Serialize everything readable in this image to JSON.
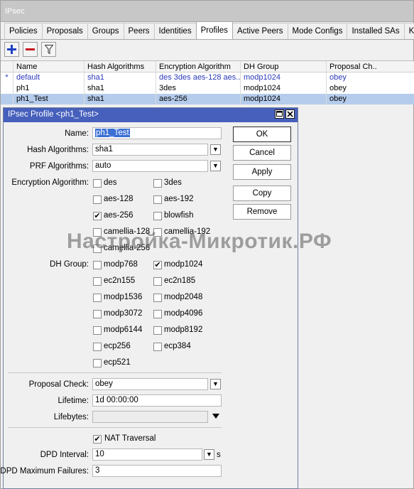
{
  "window": {
    "title": "IPsec"
  },
  "tabs": [
    "Policies",
    "Proposals",
    "Groups",
    "Peers",
    "Identities",
    "Profiles",
    "Active Peers",
    "Mode Configs",
    "Installed SAs",
    "Keys"
  ],
  "active_tab": "Profiles",
  "toolbar": {
    "add": "+",
    "remove": "−"
  },
  "grid": {
    "columns": [
      "Name",
      "Hash Algorithms",
      "Encryption Algorithm",
      "DH Group",
      "Proposal Ch..."
    ],
    "rows": [
      {
        "flag": "*",
        "name": "default",
        "hash": "sha1",
        "enc": "des 3des aes-128 aes...",
        "dh": "modp1024",
        "proposal": "obey"
      },
      {
        "flag": "",
        "name": "ph1",
        "hash": "sha1",
        "enc": "3des",
        "dh": "modp1024",
        "proposal": "obey"
      },
      {
        "flag": "",
        "name": "ph1_Test",
        "hash": "sha1",
        "enc": "aes-256",
        "dh": "modp1024",
        "proposal": "obey"
      }
    ]
  },
  "dialog": {
    "title": "IPsec Profile <ph1_Test>",
    "name_label": "Name:",
    "name_value": "ph1_Test",
    "hash_label": "Hash Algorithms:",
    "hash_value": "sha1",
    "prf_label": "PRF Algorithms:",
    "prf_value": "auto",
    "enc_label": "Encryption Algorithm:",
    "enc_options": [
      {
        "label": "des",
        "checked": false
      },
      {
        "label": "3des",
        "checked": false
      },
      {
        "label": "aes-128",
        "checked": false
      },
      {
        "label": "aes-192",
        "checked": false
      },
      {
        "label": "aes-256",
        "checked": true
      },
      {
        "label": "blowfish",
        "checked": false
      },
      {
        "label": "camellia-128",
        "checked": false
      },
      {
        "label": "camellia-192",
        "checked": false
      },
      {
        "label": "camellia-256",
        "checked": false
      }
    ],
    "dh_label": "DH Group:",
    "dh_options": [
      {
        "label": "modp768",
        "checked": false
      },
      {
        "label": "modp1024",
        "checked": true
      },
      {
        "label": "ec2n155",
        "checked": false
      },
      {
        "label": "ec2n185",
        "checked": false
      },
      {
        "label": "modp1536",
        "checked": false
      },
      {
        "label": "modp2048",
        "checked": false
      },
      {
        "label": "modp3072",
        "checked": false
      },
      {
        "label": "modp4096",
        "checked": false
      },
      {
        "label": "modp6144",
        "checked": false
      },
      {
        "label": "modp8192",
        "checked": false
      },
      {
        "label": "ecp256",
        "checked": false
      },
      {
        "label": "ecp384",
        "checked": false
      },
      {
        "label": "ecp521",
        "checked": false
      }
    ],
    "proposal_label": "Proposal Check:",
    "proposal_value": "obey",
    "lifetime_label": "Lifetime:",
    "lifetime_value": "1d 00:00:00",
    "lifebytes_label": "Lifebytes:",
    "lifebytes_value": "",
    "nat_label": "NAT Traversal",
    "nat_checked": true,
    "dpd_interval_label": "DPD Interval:",
    "dpd_interval_value": "10",
    "dpd_interval_unit": "s",
    "dpd_fail_label": "DPD Maximum Failures:",
    "dpd_fail_value": "3",
    "buttons": {
      "ok": "OK",
      "cancel": "Cancel",
      "apply": "Apply",
      "copy": "Copy",
      "remove": "Remove"
    }
  },
  "watermark": "Настройка-Микротик.РФ"
}
